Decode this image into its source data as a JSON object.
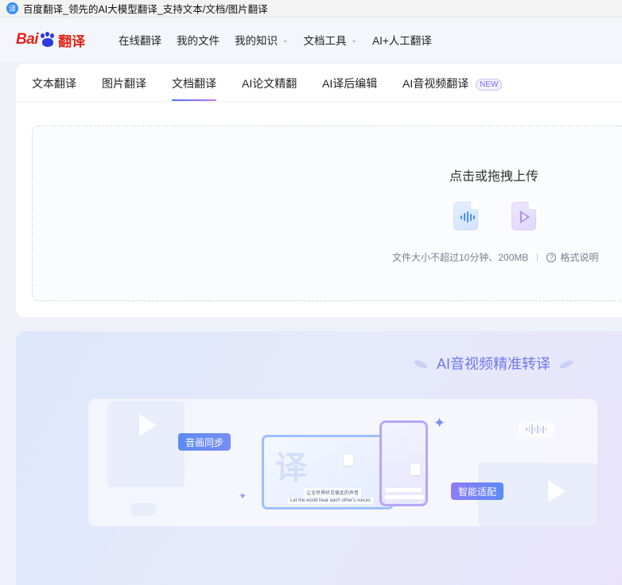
{
  "window": {
    "title": "百度翻译_领先的AI大模型翻译_支持文本/文档/图片翻译",
    "favicon_glyph": "译"
  },
  "header": {
    "logo": {
      "part1": "Bai",
      "part2": "du",
      "part3": "翻译"
    },
    "nav": [
      {
        "label": "在线翻译",
        "has_dropdown": false
      },
      {
        "label": "我的文件",
        "has_dropdown": false
      },
      {
        "label": "我的知识",
        "has_dropdown": true
      },
      {
        "label": "文档工具",
        "has_dropdown": true
      },
      {
        "label": "AI+人工翻译",
        "has_dropdown": false
      }
    ]
  },
  "tabs": [
    {
      "label": "文本翻译"
    },
    {
      "label": "图片翻译"
    },
    {
      "label": "文档翻译",
      "active": true
    },
    {
      "label": "AI论文精翻"
    },
    {
      "label": "AI译后编辑"
    },
    {
      "label": "AI音视频翻译",
      "badge": "NEW"
    }
  ],
  "upload": {
    "title": "点击或拖拽上传",
    "icons": [
      "audio-file-icon",
      "video-file-icon"
    ],
    "hint": "文件大小不超过10分钟、200MB",
    "help_link": "格式说明"
  },
  "promo": {
    "title": "AI音视频精准转译",
    "labels": {
      "sync": "音画同步",
      "adapt": "智能适配"
    },
    "subtitle_zh": "让全世界听见彼此的声音",
    "subtitle_en": "Let the world hear each other's voices"
  },
  "colors": {
    "brand_red": "#e1251b",
    "brand_blue": "#2f3ae0",
    "accent": "#4e6ef2",
    "promo_title": "#6f78ef"
  }
}
